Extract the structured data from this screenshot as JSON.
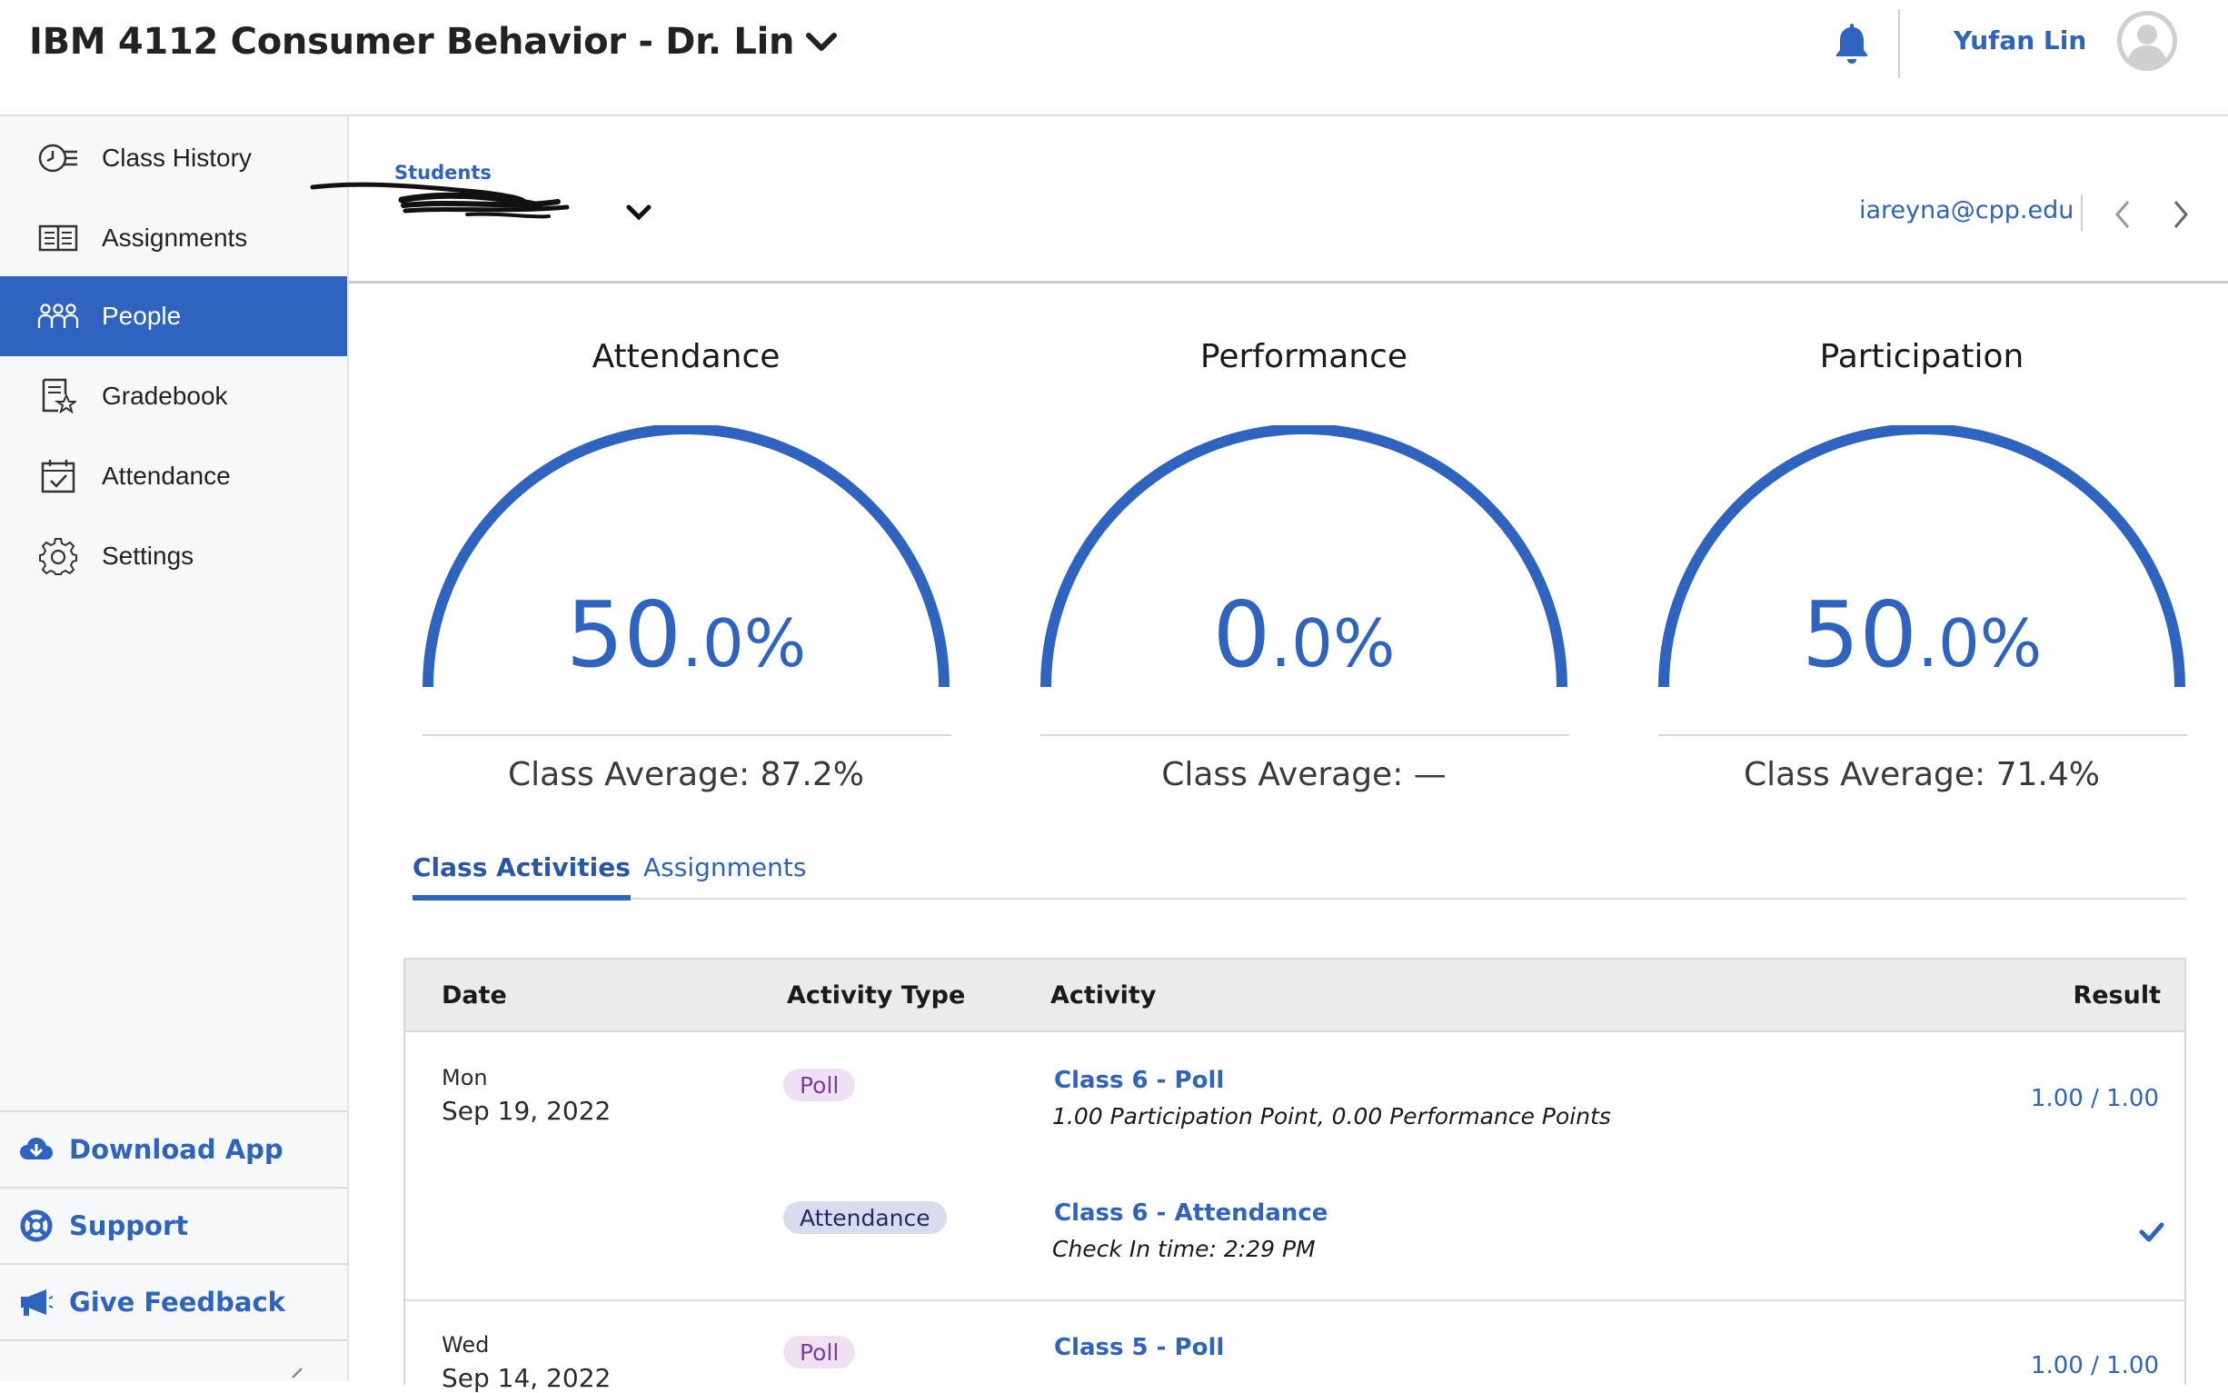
{
  "header": {
    "course_title": "IBM 4112 Consumer Behavior - Dr. Lin",
    "user_name": "Yufan Lin",
    "icons": {
      "notifications": "bell-icon",
      "dropdown": "chevron-down-icon",
      "avatar": "user-avatar-icon"
    }
  },
  "sidebar": {
    "items": [
      {
        "label": "Class History",
        "icon": "class-history-icon",
        "active": false
      },
      {
        "label": "Assignments",
        "icon": "assignments-book-icon",
        "active": false
      },
      {
        "label": "People",
        "icon": "people-icon",
        "active": true
      },
      {
        "label": "Gradebook",
        "icon": "gradebook-icon",
        "active": false
      },
      {
        "label": "Attendance",
        "icon": "calendar-check-icon",
        "active": false
      },
      {
        "label": "Settings",
        "icon": "gear-icon",
        "active": false
      }
    ],
    "bottom_links": [
      {
        "label": "Download App",
        "icon": "cloud-download-icon"
      },
      {
        "label": "Support",
        "icon": "lifebuoy-icon"
      },
      {
        "label": "Give Feedback",
        "icon": "megaphone-icon"
      }
    ]
  },
  "student_header": {
    "students_label": "Students",
    "selected_student": "",
    "email": "iareyna@cpp.edu"
  },
  "gauges": [
    {
      "title": "Attendance",
      "value_main": "50",
      "value_decimal": ".0%",
      "class_average": "Class Average: 87.2%"
    },
    {
      "title": "Performance",
      "value_main": "0",
      "value_decimal": ".0%",
      "class_average": "Class Average: —"
    },
    {
      "title": "Participation",
      "value_main": "50",
      "value_decimal": ".0%",
      "class_average": "Class Average: 71.4%"
    }
  ],
  "tabs": [
    {
      "label": "Class Activities",
      "active": true
    },
    {
      "label": "Assignments",
      "active": false
    }
  ],
  "table": {
    "headers": {
      "date": "Date",
      "activity_type": "Activity Type",
      "activity": "Activity",
      "result": "Result"
    },
    "rows": [
      {
        "day": "Mon",
        "date": "Sep 19, 2022",
        "activities": [
          {
            "type": "Poll",
            "title": "Class 6 - Poll",
            "detail": "1.00 Participation Point, 0.00 Performance Points",
            "result": "1.00 / 1.00"
          },
          {
            "type": "Attendance",
            "title": "Class 6 - Attendance",
            "detail": "Check In time: 2:29 PM",
            "result_icon": "checkmark-icon"
          }
        ]
      },
      {
        "day": "Wed",
        "date": "Sep 14, 2022",
        "activities": [
          {
            "type": "Poll",
            "title": "Class 5 - Poll",
            "result": "1.00 / 1.00"
          }
        ]
      }
    ]
  },
  "colors": {
    "accent": "#2f63c0",
    "sidebar_bg": "#f7f8fa",
    "poll_badge": "#efe1f3",
    "attendance_badge": "#d9dcef",
    "table_header": "#ebebeb"
  }
}
